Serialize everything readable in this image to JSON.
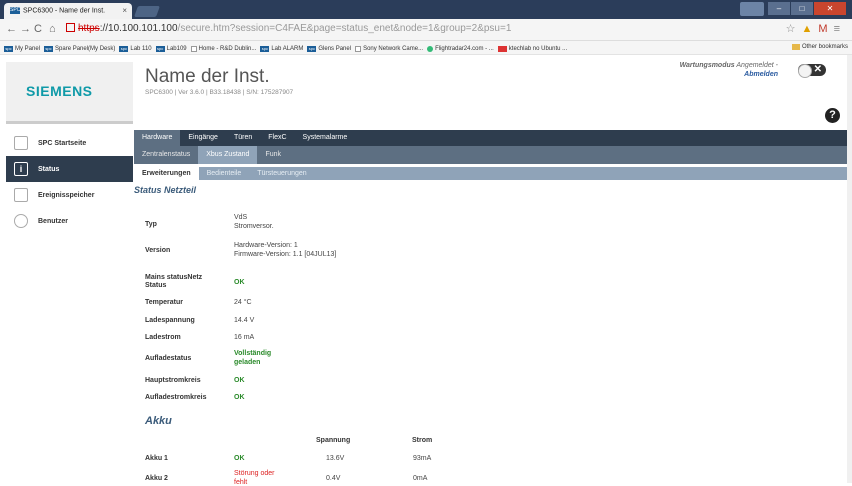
{
  "browser": {
    "tab_title": "SPC6300 - Name der Inst.",
    "tab_favicon": "SPC",
    "url_https": "https",
    "url_host": "://10.100.101.100",
    "url_path": "/secure.htm?session=C4FAE&page=status_enet&node=1&group=2&psu=1",
    "bookmarks": [
      "My Panel",
      "Spare Panel(My Desk)",
      "Lab 110",
      "Lab109",
      "Home - R&D Dublin...",
      "Lab ALARM",
      "Glens Panel",
      "Sony Network Came...",
      "Flightradar24.com - ...",
      "ktechlab no Ubuntu ..."
    ],
    "other_bookmarks": "Other bookmarks"
  },
  "header": {
    "logo": "SIEMENS",
    "installation_name": "Name der Inst.",
    "subtitle": "SPC6300 | Ver 3.6.0 | B33.18438 | S/N: 175287907",
    "mode_label": "Wartungsmodus",
    "mode_status": "Angemeldet -",
    "logout": "Abmelden"
  },
  "sidebar": {
    "items": [
      {
        "label": "SPC Startseite",
        "icon": "home-icon"
      },
      {
        "label": "Status",
        "icon": "info-icon"
      },
      {
        "label": "Ereignisspeicher",
        "icon": "document-icon"
      },
      {
        "label": "Benutzer",
        "icon": "user-icon"
      }
    ]
  },
  "nav": {
    "level1": [
      "Hardware",
      "Eingänge",
      "Türen",
      "FlexC",
      "Systemalarme"
    ],
    "level2": [
      "Zentralenstatus",
      "Xbus Zustand",
      "Funk"
    ],
    "level3": [
      "Erweiterungen",
      "Bedienteile",
      "Türsteuerungen"
    ]
  },
  "status": {
    "title": "Status Netzteil",
    "typ_label": "Typ",
    "typ_line1": "VdS",
    "typ_line2": "Stromversor.",
    "version_label": "Version",
    "version_line1": "Hardware-Version: 1",
    "version_line2": "Firmware-Version: 1.1 [04JUL13]",
    "mains_label_1": "Mains statusNetz",
    "mains_label_2": "Status",
    "mains_value": "OK",
    "temp_label": "Temperatur",
    "temp_value": "24 °C",
    "ladespannung_label": "Ladespannung",
    "ladespannung_value": "14.4 V",
    "ladestrom_label": "Ladestrom",
    "ladestrom_value": "16 mA",
    "aufladestatus_label": "Aufladestatus",
    "aufladestatus_line1": "Vollständig",
    "aufladestatus_line2": "geladen",
    "hauptstrom_label": "Hauptstromkreis",
    "hauptstrom_value": "OK",
    "aufladestrom_label": "Aufladestromkreis",
    "aufladestrom_value": "OK"
  },
  "akku": {
    "title": "Akku",
    "col_spannung": "Spannung",
    "col_strom": "Strom",
    "rows": [
      {
        "label": "Akku 1",
        "status": "OK",
        "spannung": "13.6V",
        "strom": "93mA"
      },
      {
        "label": "Akku 2",
        "status": "Störung oder",
        "status_line2": "fehlt",
        "spannung": "0.4V",
        "strom": "0mA"
      }
    ]
  },
  "colors": {
    "accent": "#0f9aa8",
    "nav_dark": "#2e3d4e",
    "ok": "#2a8a2a",
    "error": "#dd2222"
  }
}
